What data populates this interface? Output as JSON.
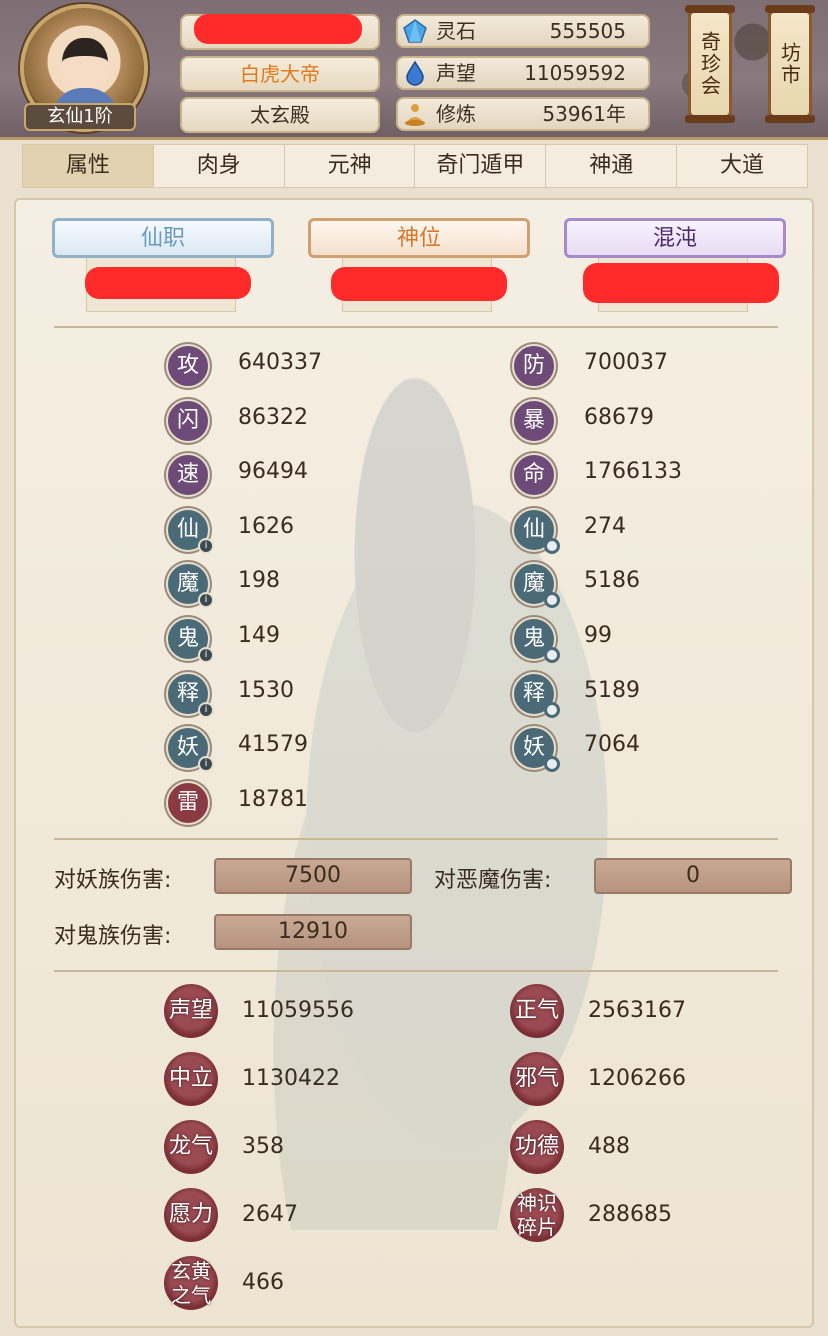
{
  "header": {
    "rank_label": "玄仙1阶",
    "title": "白虎大帝",
    "sect": "太玄殿",
    "resources": [
      {
        "icon": "spirit-stone-icon",
        "label": "灵石",
        "value": "555505"
      },
      {
        "icon": "reputation-drop-icon",
        "label": "声望",
        "value": "11059592"
      },
      {
        "icon": "cultivation-meditate-icon",
        "label": "修炼",
        "value": "53961年"
      }
    ],
    "lantern_1": "奇珍会",
    "lantern_2": "坊市"
  },
  "tabs": [
    "属性",
    "肉身",
    "元神",
    "奇门遁甲",
    "神通",
    "大道"
  ],
  "banners": [
    "仙职",
    "神位",
    "混沌"
  ],
  "stats_left": [
    {
      "label": "攻",
      "value": "640337",
      "style": "purple",
      "marker": "none"
    },
    {
      "label": "闪",
      "value": "86322",
      "style": "purple",
      "marker": "none"
    },
    {
      "label": "速",
      "value": "96494",
      "style": "purple",
      "marker": "none"
    },
    {
      "label": "仙",
      "value": "1626",
      "style": "teal",
      "marker": "info"
    },
    {
      "label": "魔",
      "value": "198",
      "style": "teal",
      "marker": "info"
    },
    {
      "label": "鬼",
      "value": "149",
      "style": "teal",
      "marker": "info"
    },
    {
      "label": "释",
      "value": "1530",
      "style": "teal",
      "marker": "info"
    },
    {
      "label": "妖",
      "value": "41579",
      "style": "teal",
      "marker": "info"
    },
    {
      "label": "雷",
      "value": "18781",
      "style": "red",
      "marker": "none"
    }
  ],
  "stats_right": [
    {
      "label": "防",
      "value": "700037",
      "style": "purple",
      "marker": "none"
    },
    {
      "label": "暴",
      "value": "68679",
      "style": "purple",
      "marker": "none"
    },
    {
      "label": "命",
      "value": "1766133",
      "style": "purple",
      "marker": "none"
    },
    {
      "label": "仙",
      "value": "274",
      "style": "teal",
      "marker": "ring"
    },
    {
      "label": "魔",
      "value": "5186",
      "style": "teal",
      "marker": "ring"
    },
    {
      "label": "鬼",
      "value": "99",
      "style": "teal",
      "marker": "ring"
    },
    {
      "label": "释",
      "value": "5189",
      "style": "teal",
      "marker": "ring"
    },
    {
      "label": "妖",
      "value": "7064",
      "style": "teal",
      "marker": "ring"
    }
  ],
  "damage": [
    {
      "label": "对妖族伤害:",
      "value": "7500"
    },
    {
      "label": "对恶魔伤害:",
      "value": "0"
    },
    {
      "label": "对鬼族伤害:",
      "value": "12910"
    }
  ],
  "misc_left": [
    {
      "label": "声望",
      "value": "11059556"
    },
    {
      "label": "中立",
      "value": "1130422"
    },
    {
      "label": "龙气",
      "value": "358"
    },
    {
      "label": "愿力",
      "value": "2647"
    },
    {
      "label": "玄黄之气",
      "value": "466"
    }
  ],
  "misc_right": [
    {
      "label": "正气",
      "value": "2563167"
    },
    {
      "label": "邪气",
      "value": "1206266"
    },
    {
      "label": "功德",
      "value": "488"
    },
    {
      "label": "神识碎片",
      "value": "288685"
    }
  ]
}
